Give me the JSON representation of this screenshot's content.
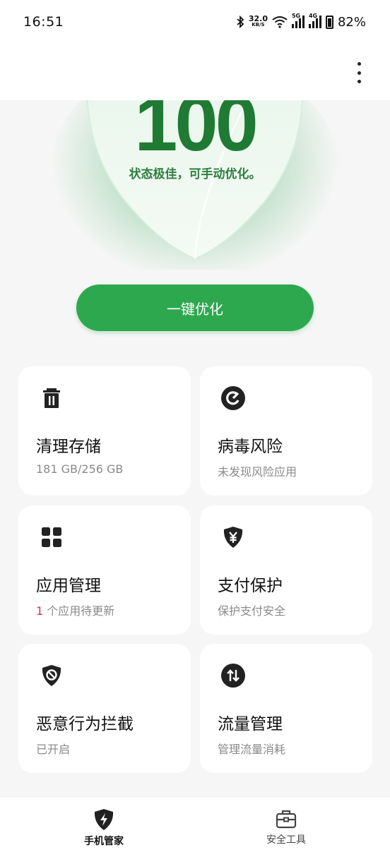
{
  "status_bar": {
    "time": "16:51",
    "speed_value": "32.0",
    "speed_unit": "KB/S",
    "net1": "5G",
    "net2": "4G",
    "battery": "82%"
  },
  "hero": {
    "score": "100",
    "subtitle": "状态极佳，可手动优化。"
  },
  "optimize_button": "一键优化",
  "cards": [
    {
      "title": "清理存储",
      "sub": "181 GB/256 GB",
      "icon": "trash-icon"
    },
    {
      "title": "病毒风险",
      "sub": "未发现风险应用",
      "icon": "virus-scan-icon"
    },
    {
      "title": "应用管理",
      "sub_count": "1",
      "sub": " 个应用待更新",
      "icon": "apps-grid-icon"
    },
    {
      "title": "支付保护",
      "sub": "保护支付安全",
      "icon": "payment-shield-icon"
    },
    {
      "title": "恶意行为拦截",
      "sub": "已开启",
      "icon": "block-shield-icon"
    },
    {
      "title": "流量管理",
      "sub": "管理流量消耗",
      "icon": "data-traffic-icon"
    }
  ],
  "bottom_nav": {
    "home_label": "手机管家",
    "tools_label": "安全工具"
  },
  "colors": {
    "accent": "#2ea84f",
    "score": "#1f7a34",
    "highlight": "#d9363e"
  }
}
